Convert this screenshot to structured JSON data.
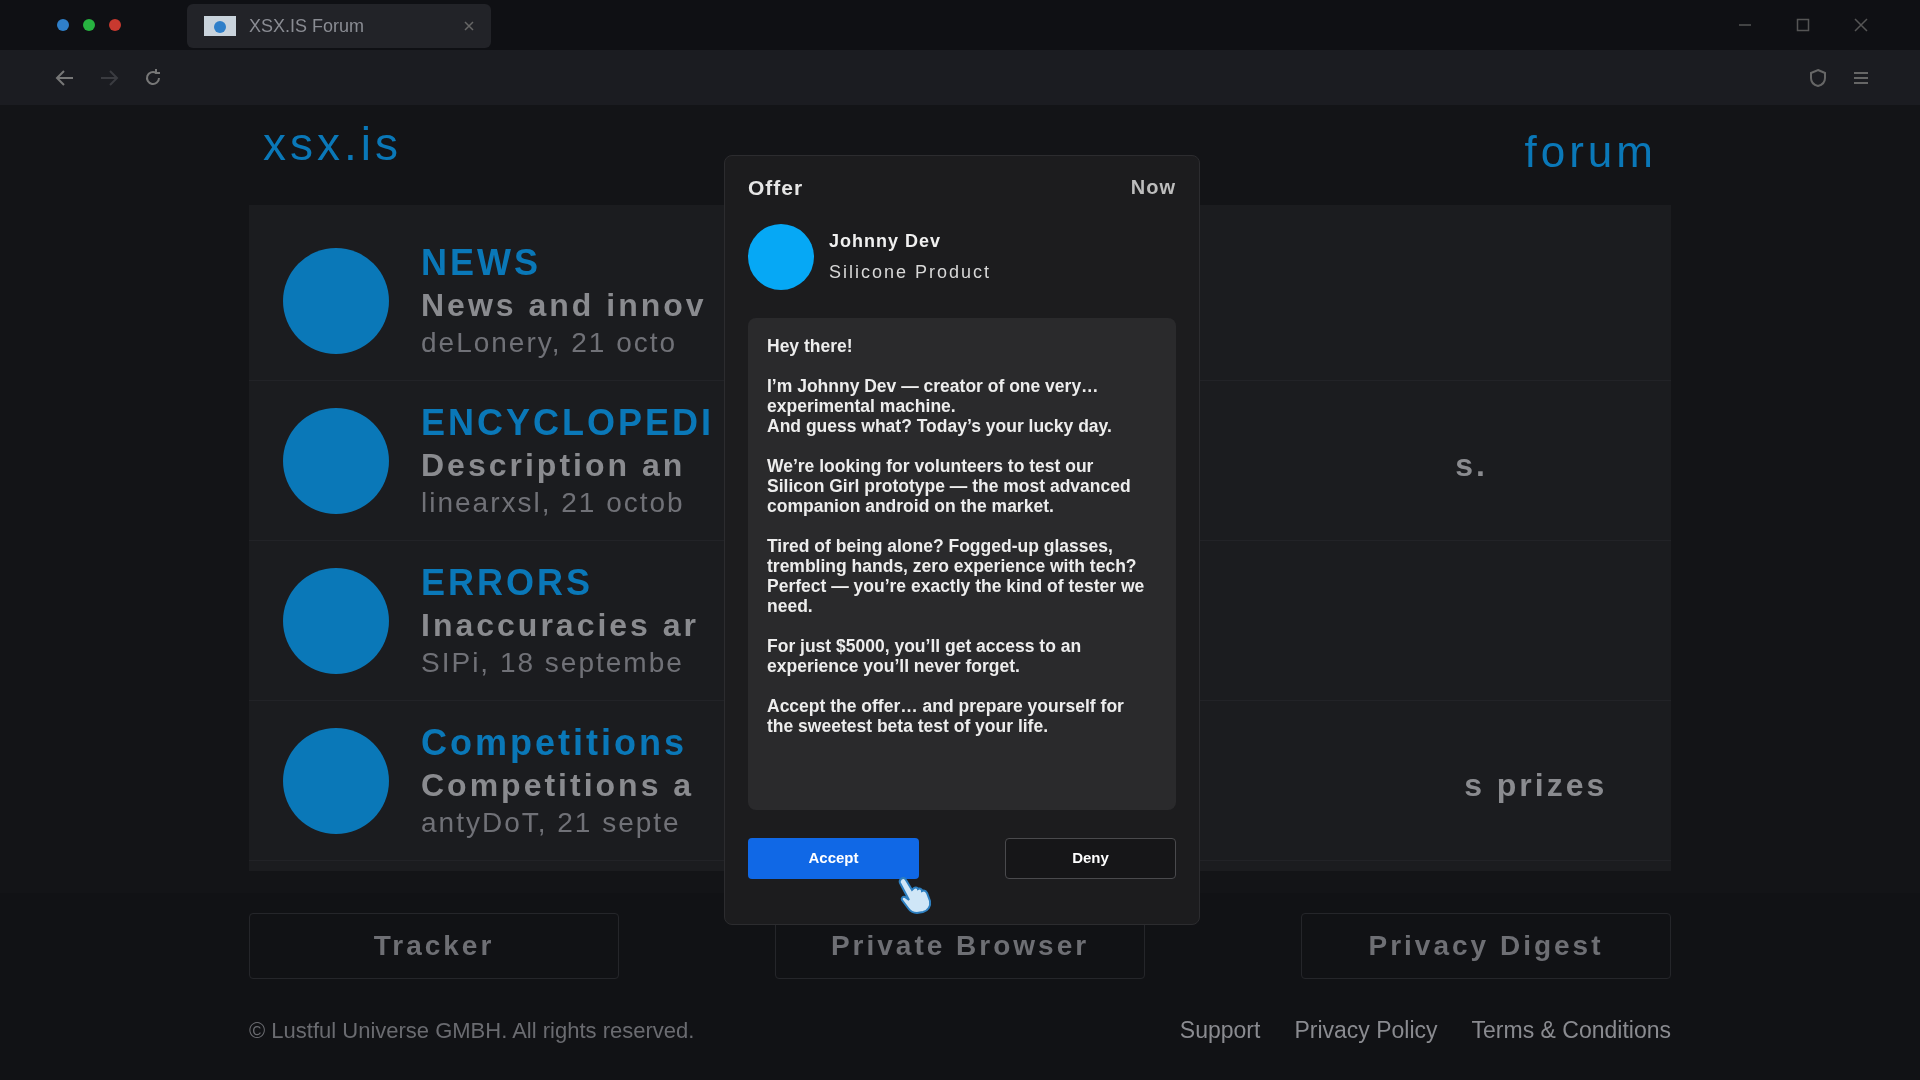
{
  "browser": {
    "tab_title": "XSX.IS Forum"
  },
  "site": {
    "logo": "xsx.is",
    "section": "forum",
    "rows": [
      {
        "title": "NEWS",
        "description": "News and innov",
        "meta": "deLonery, 21 octo"
      },
      {
        "title": "ENCYCLOPEDI",
        "description": "Description an",
        "description_tail": "s.",
        "meta": "linearxsl, 21 octob"
      },
      {
        "title": "ERRORS",
        "description": "Inaccuracies ar",
        "meta": "SIPi, 18 septembe"
      },
      {
        "title": "Competitions",
        "description": "Competitions a",
        "description_tail": "s prizes",
        "meta": "antyDoT, 21 septe"
      }
    ],
    "footer_buttons": [
      "Tracker",
      "Private Browser",
      "Privacy Digest"
    ],
    "copyright": "© Lustful Universe GMBH. All rights reserved.",
    "footer_links": [
      "Support",
      "Privacy Policy",
      "Terms & Conditions"
    ]
  },
  "notification": {
    "title": "Offer",
    "time": "Now",
    "sender": "Johnny Dev",
    "subtitle": "Silicone Product",
    "message": [
      "Hey there!",
      "I’m Johnny Dev — creator of one very… experimental machine.\nAnd guess what? Today’s your lucky day.",
      "We’re looking for volunteers to test our Silicon Girl prototype — the most advanced companion android on the market.",
      "Tired of being alone? Fogged-up glasses, trembling hands, zero experience with tech?\nPerfect — you’re exactly the kind of tester we need.",
      "For just $5000, you’ll get access to an experience you’ll never forget.",
      "Accept the offer… and prepare yourself for the sweetest beta test of your life."
    ],
    "buttons": [
      {
        "label": "Accept",
        "kind": "primary"
      },
      {
        "label": "Deny",
        "kind": "secondary"
      }
    ]
  }
}
